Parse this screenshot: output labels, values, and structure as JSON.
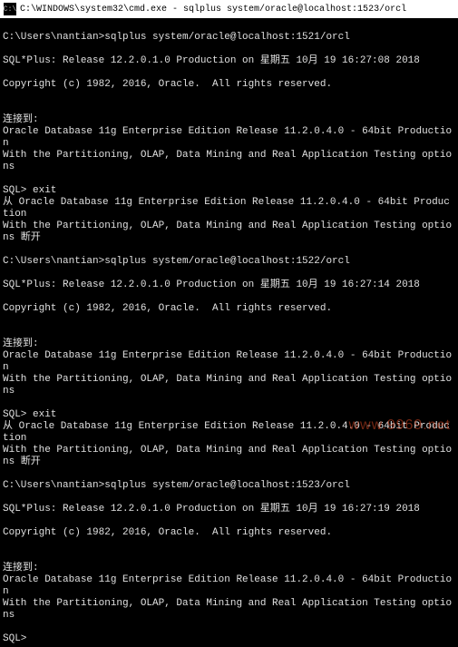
{
  "titlebar": {
    "icon": "C:\\",
    "text": "C:\\WINDOWS\\system32\\cmd.exe - sqlplus  system/oracle@localhost:1523/orcl"
  },
  "lines": [
    "",
    "C:\\Users\\nantian>sqlplus system/oracle@localhost:1521/orcl",
    "",
    "SQL*Plus: Release 12.2.0.1.0 Production on 星期五 10月 19 16:27:08 2018",
    "",
    "Copyright (c) 1982, 2016, Oracle.  All rights reserved.",
    "",
    "",
    "连接到:",
    "Oracle Database 11g Enterprise Edition Release 11.2.0.4.0 - 64bit Production",
    "With the Partitioning, OLAP, Data Mining and Real Application Testing options",
    "",
    "SQL> exit",
    "从 Oracle Database 11g Enterprise Edition Release 11.2.0.4.0 - 64bit Production",
    "With the Partitioning, OLAP, Data Mining and Real Application Testing options 断开",
    "",
    "C:\\Users\\nantian>sqlplus system/oracle@localhost:1522/orcl",
    "",
    "SQL*Plus: Release 12.2.0.1.0 Production on 星期五 10月 19 16:27:14 2018",
    "",
    "Copyright (c) 1982, 2016, Oracle.  All rights reserved.",
    "",
    "",
    "连接到:",
    "Oracle Database 11g Enterprise Edition Release 11.2.0.4.0 - 64bit Production",
    "With the Partitioning, OLAP, Data Mining and Real Application Testing options",
    "",
    "SQL> exit",
    "从 Oracle Database 11g Enterprise Edition Release 11.2.0.4.0 - 64bit Production",
    "With the Partitioning, OLAP, Data Mining and Real Application Testing options 断开",
    "",
    "C:\\Users\\nantian>sqlplus system/oracle@localhost:1523/orcl",
    "",
    "SQL*Plus: Release 12.2.0.1.0 Production on 星期五 10月 19 16:27:19 2018",
    "",
    "Copyright (c) 1982, 2016, Oracle.  All rights reserved.",
    "",
    "",
    "连接到:",
    "Oracle Database 11g Enterprise Edition Release 11.2.0.4.0 - 64bit Production",
    "With the Partitioning, OLAP, Data Mining and Real Application Testing options",
    "",
    "SQL>"
  ],
  "watermark": "www.9969.net"
}
